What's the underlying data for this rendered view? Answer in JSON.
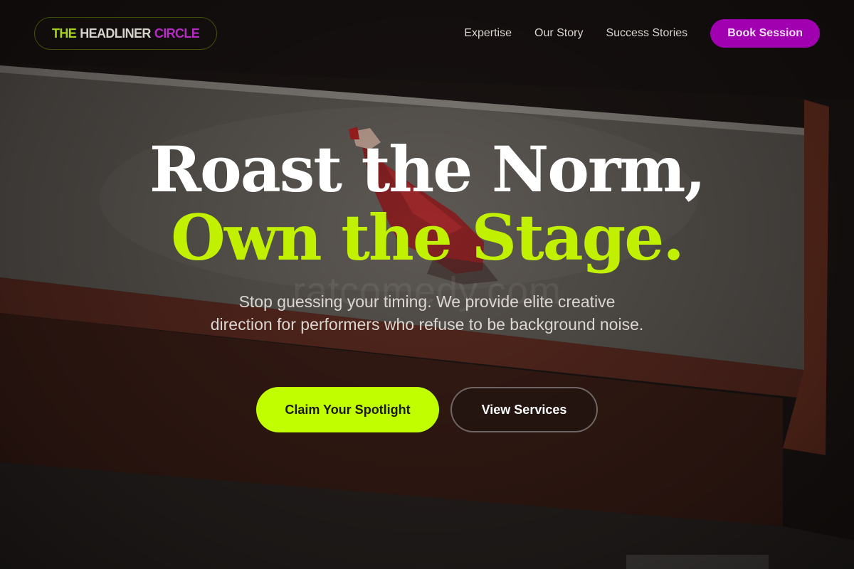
{
  "brand": {
    "word1": "THE",
    "word2": "HEADLINER",
    "word3": "CIRCLE"
  },
  "nav": {
    "links": [
      "Expertise",
      "Our Story",
      "Success Stories"
    ],
    "cta_label": "Book Session"
  },
  "hero": {
    "title_line1": "Roast the Norm,",
    "title_line2": "Own the Stage.",
    "subtitle": "Stop guessing your timing. We provide elite creative direction for performers who refuse to be background noise.",
    "primary_button": "Claim Your Spotlight",
    "secondary_button": "View Services"
  },
  "watermark": "ratcomedy.com",
  "colors": {
    "accent_lime": "#c1ff00",
    "accent_magenta": "#a000b0",
    "background": "#1b1514"
  }
}
